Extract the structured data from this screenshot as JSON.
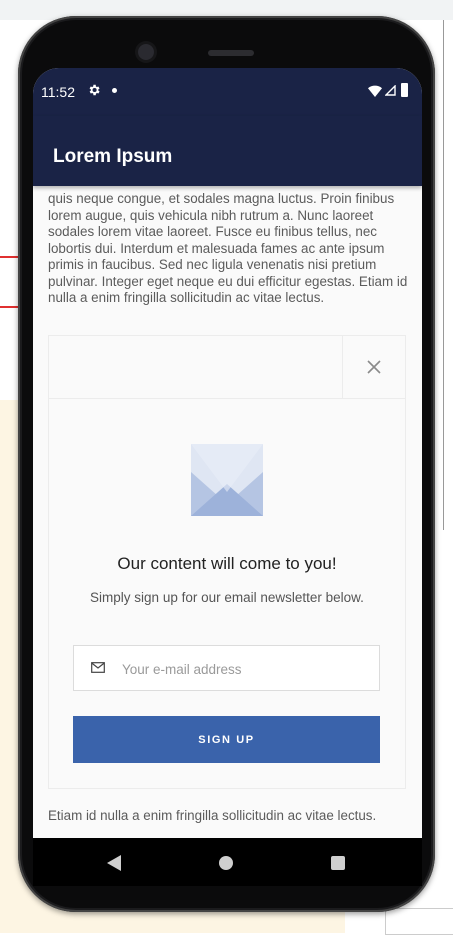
{
  "status_bar": {
    "time": "11:52"
  },
  "app_bar": {
    "title": "Lorem Ipsum"
  },
  "article": {
    "paragraph": "quis neque congue, et sodales magna luctus. Proin finibus lorem augue, quis vehicula nibh rutrum a. Nunc laoreet sodales lorem vitae laoreet. Fusce eu finibus tellus, nec lobortis dui. Interdum et malesuada fames ac ante ipsum primis in faucibus. Sed nec ligula venenatis nisi pretium pulvinar. Integer eget neque eu dui efficitur egestas. Etiam id nulla a enim fringilla sollicitudin ac vitae lectus.",
    "footer": "Etiam id nulla a enim fringilla sollicitudin ac vitae lectus."
  },
  "newsletter": {
    "title": "Our content will come to you!",
    "subtitle": "Simply sign up for our email newsletter below.",
    "email_placeholder": "Your e-mail address",
    "signup_label": "SIGN UP",
    "icons": [
      "close-icon",
      "mail-illustration",
      "envelope-icon"
    ]
  },
  "navigation": {
    "icons": [
      "back-icon",
      "home-icon",
      "recents-icon"
    ]
  },
  "colors": {
    "app_bar": "#1a2346",
    "signup_button": "#3a63ab"
  }
}
